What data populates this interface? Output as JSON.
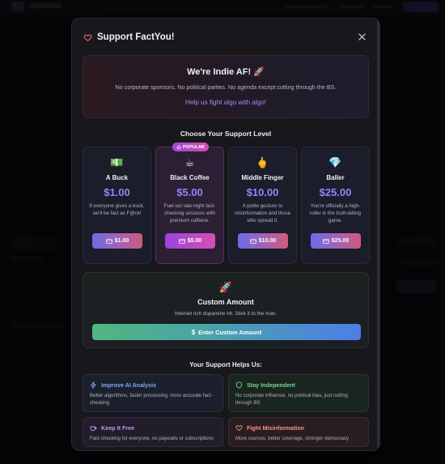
{
  "modal": {
    "title": "Support FactYou!",
    "accent_color": "#e06a72"
  },
  "hero": {
    "title": "We're Indie AF! 🚀",
    "subtitle": "No corporate sponsors. No political parties. No agenda except cutting through the BS.",
    "link": "Help us fight algo with algo!"
  },
  "support_section": {
    "title": "Choose Your Support Level",
    "popular_badge": "POPULAR",
    "tiers": [
      {
        "emoji": "💵",
        "name": "A Buck",
        "price": "$1.00",
        "description": "If everyone gives a buck, we'll be fact as F@ck!",
        "button": "$1.00",
        "popular": false
      },
      {
        "emoji": "☕",
        "name": "Black Coffee",
        "price": "$5.00",
        "description": "Fuel our late-night fact-checking sessions with premium caffeine.",
        "button": "$5.00",
        "popular": true
      },
      {
        "emoji": "🖕",
        "name": "Middle Finger",
        "price": "$10.00",
        "description": "A polite gesture to misinformation and those who spread it.",
        "button": "$10.00",
        "popular": false
      },
      {
        "emoji": "💎",
        "name": "Baller",
        "price": "$25.00",
        "description": "You're officially a high-roller in the truth-telling game.",
        "button": "$25.00",
        "popular": false
      }
    ]
  },
  "custom": {
    "emoji": "🚀",
    "title": "Custom Amount",
    "subtitle": "Internet rich dopamine hit. Stick it to the man.",
    "button": "Enter Custom Amount"
  },
  "benefits": {
    "title": "Your Support Helps Us:",
    "items": [
      {
        "icon": "lightning-icon",
        "title": "Improve AI Analysis",
        "description": "Better algorithms, faster processing, more accurate fact-checking",
        "color": "#7fa8f4"
      },
      {
        "icon": "shield-icon",
        "title": "Stay Independent",
        "description": "No corporate influence, no political bias, just cutting through BS",
        "color": "#76d394"
      },
      {
        "icon": "coffee-icon",
        "title": "Keep It Free",
        "description": "Fact-checking for everyone, no paywalls or subscriptions",
        "color": "#c39af2"
      },
      {
        "icon": "heart-icon",
        "title": "Fight Misinformation",
        "description": "More sources, better coverage, stronger democracy",
        "color": "#f19296"
      }
    ]
  }
}
